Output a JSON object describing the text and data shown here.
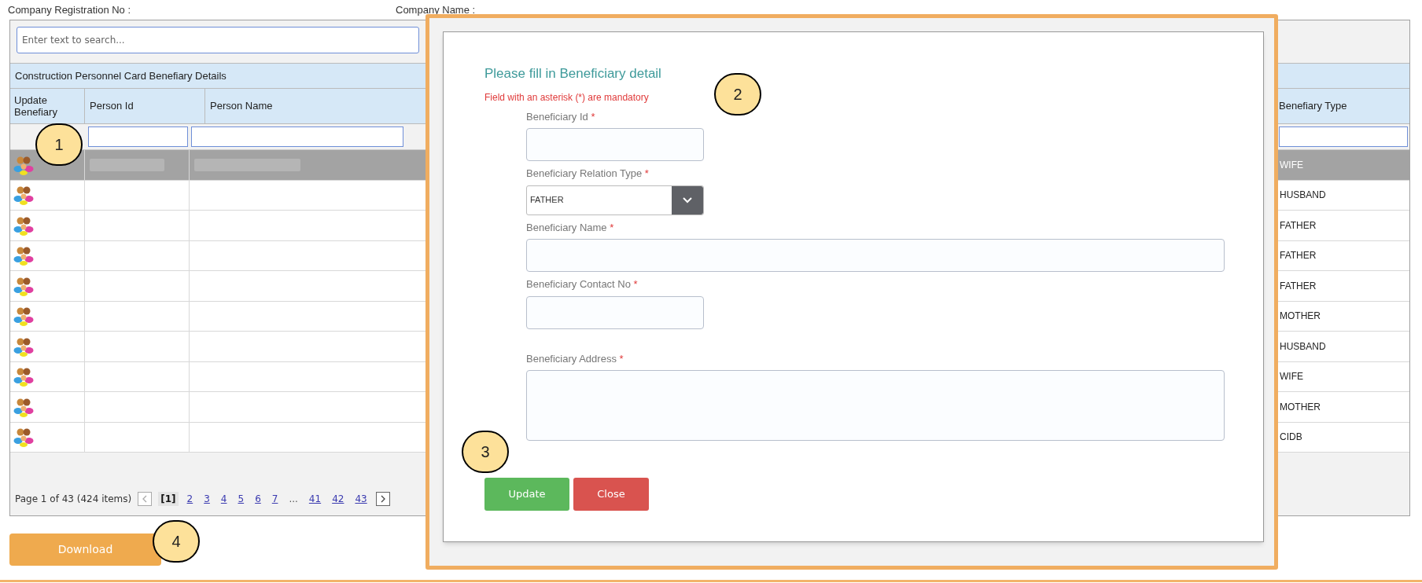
{
  "header": {
    "registration_label": "Company Registration No :",
    "company_label": "Company Name :"
  },
  "search": {
    "placeholder": "Enter text to search..."
  },
  "grid": {
    "title": "Construction Personnel Card Benefiary Details",
    "columns": [
      "Update Benefiary",
      "Person Id",
      "Person Name",
      "Benefiary Type"
    ],
    "rows": [
      {
        "selected": true,
        "redacted": true,
        "type": "WIFE"
      },
      {
        "selected": false,
        "redacted": false,
        "type": "HUSBAND"
      },
      {
        "selected": false,
        "redacted": false,
        "type": "FATHER"
      },
      {
        "selected": false,
        "redacted": false,
        "type": "FATHER"
      },
      {
        "selected": false,
        "redacted": false,
        "type": "FATHER"
      },
      {
        "selected": false,
        "redacted": false,
        "type": "MOTHER"
      },
      {
        "selected": false,
        "redacted": false,
        "type": "HUSBAND"
      },
      {
        "selected": false,
        "redacted": false,
        "type": "WIFE"
      },
      {
        "selected": false,
        "redacted": false,
        "type": "MOTHER"
      },
      {
        "selected": false,
        "redacted": false,
        "type": "CIDB"
      }
    ]
  },
  "pager": {
    "summary": "Page 1 of 43 (424 items)",
    "pages": [
      {
        "label": "[1]",
        "selected": true
      },
      {
        "label": "2",
        "selected": false
      },
      {
        "label": "3",
        "selected": false
      },
      {
        "label": "4",
        "selected": false
      },
      {
        "label": "5",
        "selected": false
      },
      {
        "label": "6",
        "selected": false
      },
      {
        "label": "7",
        "selected": false
      },
      {
        "label": "...",
        "kind": "ellipsis"
      },
      {
        "label": "41",
        "selected": false
      },
      {
        "label": "42",
        "selected": false
      },
      {
        "label": "43",
        "selected": false
      }
    ]
  },
  "download_button": "Download",
  "modal": {
    "title": "Please fill in Beneficiary detail",
    "note": "Field with an asterisk (*) are mandatory",
    "fields": [
      {
        "kind": "short_input",
        "label": "Beneficiary Id",
        "required_mark": "*"
      },
      {
        "kind": "select",
        "label": "Beneficiary Relation Type",
        "required_mark": "*",
        "value": "FATHER"
      },
      {
        "kind": "wide_input",
        "label": "Beneficiary Name",
        "required_mark": "*"
      },
      {
        "kind": "short_input",
        "label": "Beneficiary Contact No",
        "required_mark": "*"
      },
      {
        "kind": "textarea",
        "label": "Beneficiary Address",
        "required_mark": "*"
      }
    ],
    "buttons": [
      {
        "label": "Update",
        "kind": "primary"
      },
      {
        "label": "Close",
        "kind": "danger"
      }
    ]
  },
  "callouts": [
    "1",
    "2",
    "3",
    "4"
  ]
}
